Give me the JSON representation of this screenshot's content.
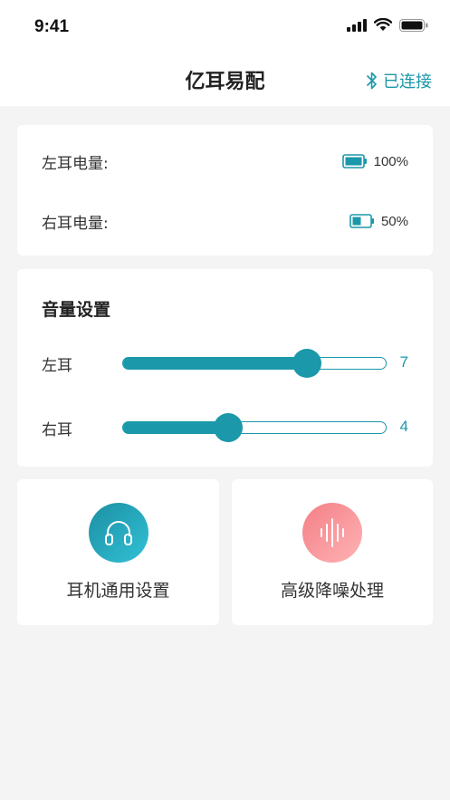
{
  "status_bar": {
    "time": "9:41"
  },
  "nav": {
    "title": "亿耳易配",
    "bluetooth_status": "已连接"
  },
  "battery": {
    "left": {
      "label": "左耳电量:",
      "value": "100%",
      "level": 1.0
    },
    "right": {
      "label": "右耳电量:",
      "value": "50%",
      "level": 0.5
    }
  },
  "volume": {
    "title": "音量设置",
    "max": 10,
    "left": {
      "label": "左耳",
      "value": 7
    },
    "right": {
      "label": "右耳",
      "value": 4
    }
  },
  "features": [
    {
      "label": "耳机通用设置",
      "icon": "headphones-icon"
    },
    {
      "label": "高级降噪处理",
      "icon": "sound-wave-icon"
    }
  ],
  "colors": {
    "accent": "#1b98aa",
    "background": "#f4f4f4"
  }
}
